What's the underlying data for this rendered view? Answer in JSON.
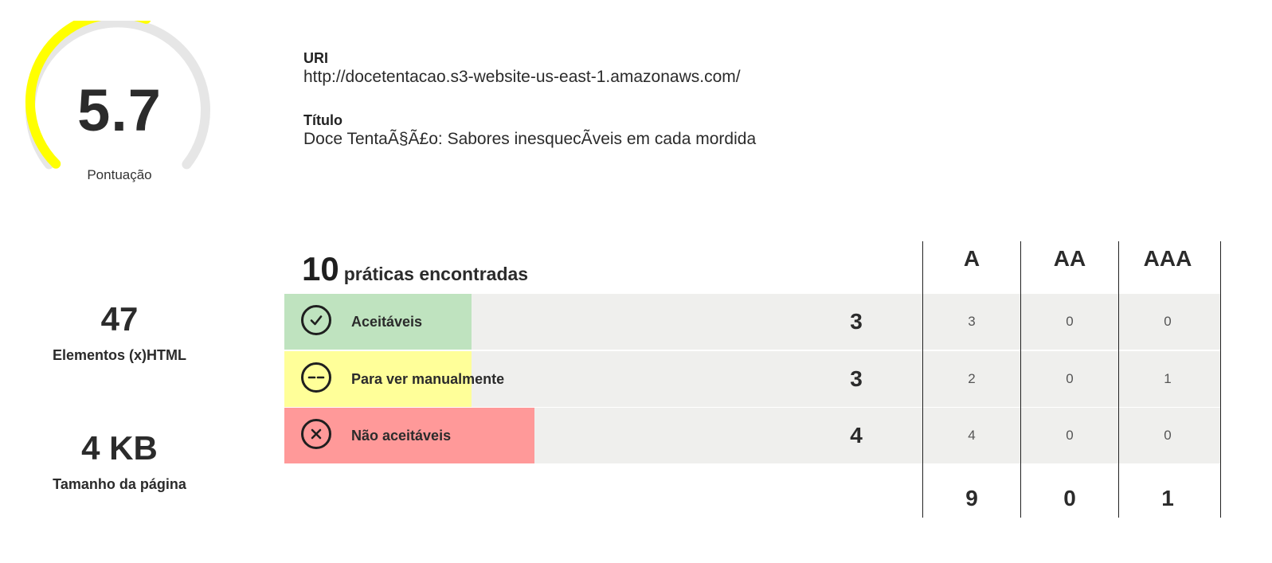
{
  "score": {
    "value": "5.7",
    "label": "Pontuação",
    "fraction": 0.57
  },
  "info": {
    "uri_label": "URI",
    "uri_value": "http://docetentacao.s3-website-us-east-1.amazonaws.com/",
    "title_label": "Título",
    "title_value": "Doce TentaÃ§Ã£o: Sabores inesquecÃveis em cada mordida"
  },
  "stats": {
    "elements_value": "47",
    "elements_label": "Elementos (x)HTML",
    "size_value": "4 KB",
    "size_label": "Tamanho da página"
  },
  "practices": {
    "count": "10",
    "label": "práticas encontradas",
    "levels": [
      "A",
      "AA",
      "AAA"
    ],
    "rows": [
      {
        "name": "Aceitáveis",
        "count": "3",
        "a": "3",
        "aa": "0",
        "aaa": "0",
        "fraction": 0.3
      },
      {
        "name": "Para ver manualmente",
        "count": "3",
        "a": "2",
        "aa": "0",
        "aaa": "1",
        "fraction": 0.3
      },
      {
        "name": "Não aceitáveis",
        "count": "4",
        "a": "4",
        "aa": "0",
        "aaa": "0",
        "fraction": 0.4
      }
    ],
    "totals": {
      "a": "9",
      "aa": "0",
      "aaa": "1"
    }
  },
  "colors": {
    "gauge_fill": "#ffff00",
    "gauge_track": "#e6e6e6",
    "acceptable": "#bfe3bf",
    "manual": "#ffff99",
    "not_acceptable": "#ff9999",
    "row_background": "#efefed"
  },
  "icons": {
    "acceptable": "check-circle-icon",
    "manual": "dash-circle-icon",
    "not_acceptable": "x-circle-icon"
  }
}
